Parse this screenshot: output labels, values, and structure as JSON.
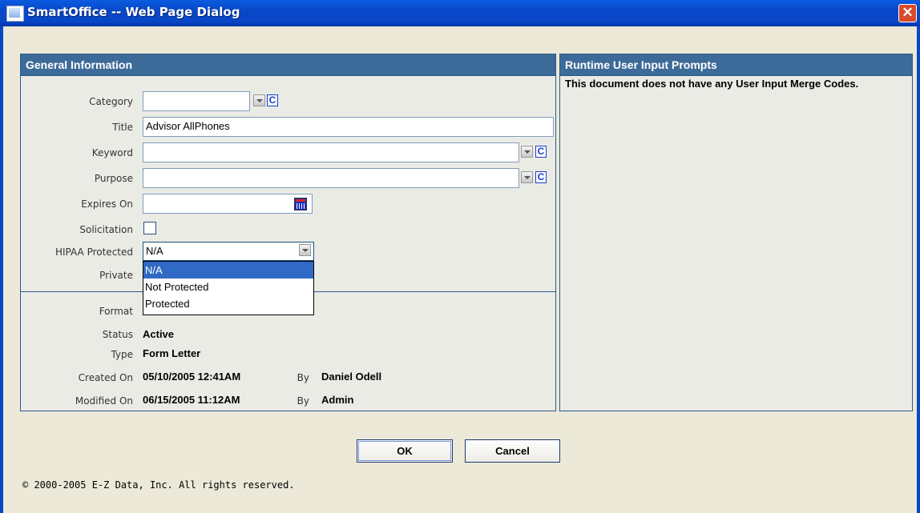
{
  "window": {
    "title": "SmartOffice -- Web Page Dialog",
    "close_glyph": "✕"
  },
  "general": {
    "header": "General Information",
    "labels": {
      "category": "Category",
      "title": "Title",
      "keyword": "Keyword",
      "purpose": "Purpose",
      "expires_on": "Expires On",
      "solicitation": "Solicitation",
      "hipaa": "HIPAA Protected",
      "private": "Private",
      "format": "Format",
      "status": "Status",
      "type": "Type",
      "created_on": "Created On",
      "modified_on": "Modified On",
      "by": "By"
    },
    "values": {
      "category": "",
      "title": "Advisor AllPhones",
      "keyword": "",
      "purpose": "",
      "expires_on": "",
      "solicitation_checked": false,
      "hipaa": "N/A",
      "status": "Active",
      "type": "Form Letter",
      "created_on": "05/10/2005 12:41AM",
      "created_by": "Daniel Odell",
      "modified_on": "06/15/2005 11:12AM",
      "modified_by": "Admin"
    },
    "hipaa_options": [
      "N/A",
      "Not Protected",
      "Protected"
    ],
    "hipaa_selected_index": 0,
    "c_glyph": "C"
  },
  "runtime": {
    "header": "Runtime User Input Prompts",
    "message": "This document does not have any User Input Merge Codes."
  },
  "buttons": {
    "ok": "OK",
    "cancel": "Cancel"
  },
  "footer": {
    "copyright": "© 2000-2005 E-Z Data, Inc. All rights reserved."
  },
  "colors": {
    "titlebar": "#0a47c8",
    "panel_header": "#3d6b99",
    "selection": "#316ac5",
    "dialog_bg": "#ece9d8"
  }
}
